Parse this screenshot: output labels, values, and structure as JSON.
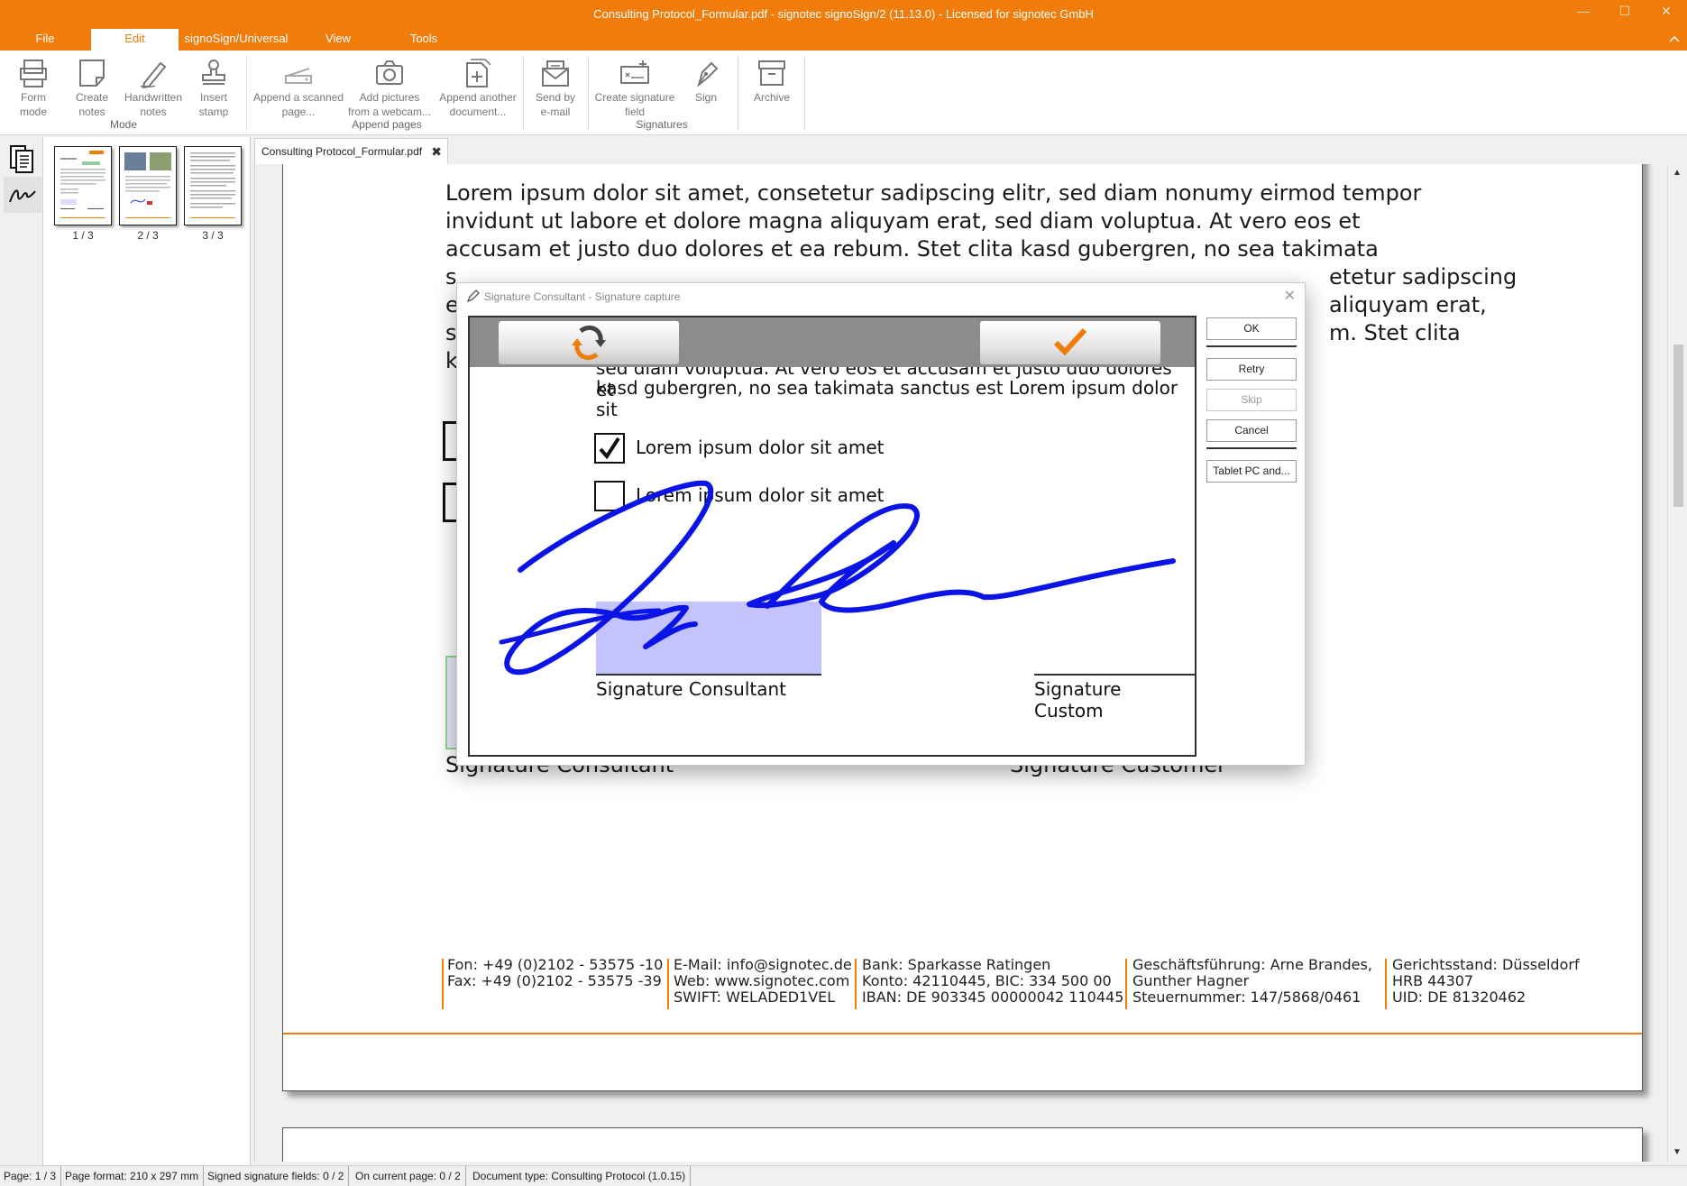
{
  "app": {
    "title": "Consulting Protocol_Formular.pdf - signotec signoSign/2 (11.13.0) - Licensed for signotec GmbH",
    "accent_color": "#f07c0c",
    "window_controls": [
      "—",
      "☐",
      "✕"
    ]
  },
  "menu": {
    "tabs": [
      "File",
      "Edit",
      "signoSign/Universal",
      "View",
      "Tools"
    ],
    "active": "Edit",
    "collapse_icon": "chevron-up"
  },
  "ribbon": {
    "groups": [
      {
        "name": "Mode",
        "buttons": [
          {
            "label1": "Form",
            "label2": "mode",
            "icon": "form-mode-icon"
          },
          {
            "label1": "Create",
            "label2": "notes",
            "icon": "note-icon"
          },
          {
            "label1": "Handwritten",
            "label2": "notes",
            "icon": "pen-icon"
          },
          {
            "label1": "Insert",
            "label2": "stamp",
            "icon": "stamp-icon"
          }
        ]
      },
      {
        "name": "Append pages",
        "buttons": [
          {
            "label1": "Append a scanned",
            "label2": "page...",
            "icon": "scanner-icon"
          },
          {
            "label1": "Add pictures",
            "label2": "from a webcam...",
            "icon": "camera-icon"
          },
          {
            "label1": "Append another",
            "label2": "document...",
            "icon": "add-document-icon"
          }
        ]
      },
      {
        "name": "",
        "buttons": [
          {
            "label1": "Send by",
            "label2": "e-mail",
            "icon": "mail-icon"
          }
        ]
      },
      {
        "name": "Signatures",
        "buttons": [
          {
            "label1": "Create signature",
            "label2": "field",
            "icon": "signature-field-icon"
          },
          {
            "label1": "Sign",
            "label2": "",
            "icon": "fountain-pen-icon"
          }
        ]
      },
      {
        "name": "",
        "buttons": [
          {
            "label1": "Archive",
            "label2": "",
            "icon": "archive-icon"
          }
        ]
      }
    ]
  },
  "thumbnails": [
    {
      "label": "1 / 3"
    },
    {
      "label": "2 / 3"
    },
    {
      "label": "3 / 3"
    }
  ],
  "document_tab": {
    "name": "Consulting Protocol_Formular.pdf",
    "close": "✖"
  },
  "document": {
    "paragraph_lines": [
      "Lorem ipsum dolor sit amet, consetetur sadipscing elitr, sed diam nonumy eirmod tempor",
      "invidunt ut labore et dolore magna aliquyam erat, sed diam voluptua. At vero eos et",
      "accusam et justo duo dolores et ea rebum. Stet clita kasd gubergren, no sea takimata",
      "s",
      "e",
      "s",
      "k"
    ],
    "paragraph_right_fragments": [
      "etetur sadipscing",
      "aliquyam erat,",
      "m. Stet clita"
    ],
    "signature_labels": [
      "Signature Consultant",
      "Signature Customer"
    ],
    "footer_columns": [
      [
        "Fon: +49 (0)2102 - 53575 -10",
        "Fax: +49 (0)2102 - 53575 -39"
      ],
      [
        "E-Mail: info@signotec.de",
        "Web: www.signotec.com",
        "SWIFT: WELADED1VEL"
      ],
      [
        "Bank: Sparkasse Ratingen",
        "Konto: 42110445, BIC: 334 500 00",
        "IBAN: DE 903345 00000042 110445"
      ],
      [
        "Geschäftsführung: Arne Brandes,",
        "Gunther Hagner",
        "Steuernummer: 147/5868/0461"
      ],
      [
        "Gerichtsstand: Düsseldorf",
        "HRB 44307",
        "UID: DE 81320462"
      ]
    ]
  },
  "dialog": {
    "title": "Signature Consultant - Signature capture",
    "canvas_text_lines": [
      "sed diam voluptua. At vero eos et accusam et justo duo dolores et",
      "kasd gubergren, no sea takimata sanctus est Lorem ipsum dolor sit"
    ],
    "checkboxes": [
      {
        "label": "Lorem ipsum dolor sit amet",
        "checked": true
      },
      {
        "label": "Lorem ipsum dolor sit amet",
        "checked": false
      }
    ],
    "sig_label_left": "Signature Consultant",
    "sig_label_right": "Signature Custom",
    "ink_color": "#0a14e6",
    "buttons": {
      "ok": "OK",
      "retry": "Retry",
      "skip": "Skip",
      "cancel": "Cancel",
      "tablet": "Tablet PC and..."
    }
  },
  "status": {
    "page": "Page: 1 / 3",
    "format": "Page format: 210 x 297 mm",
    "signed": "Signed signature fields: 0 / 2",
    "current": "On current page: 0 / 2",
    "doctype": "Document type: Consulting Protocol (1.0.15)"
  }
}
